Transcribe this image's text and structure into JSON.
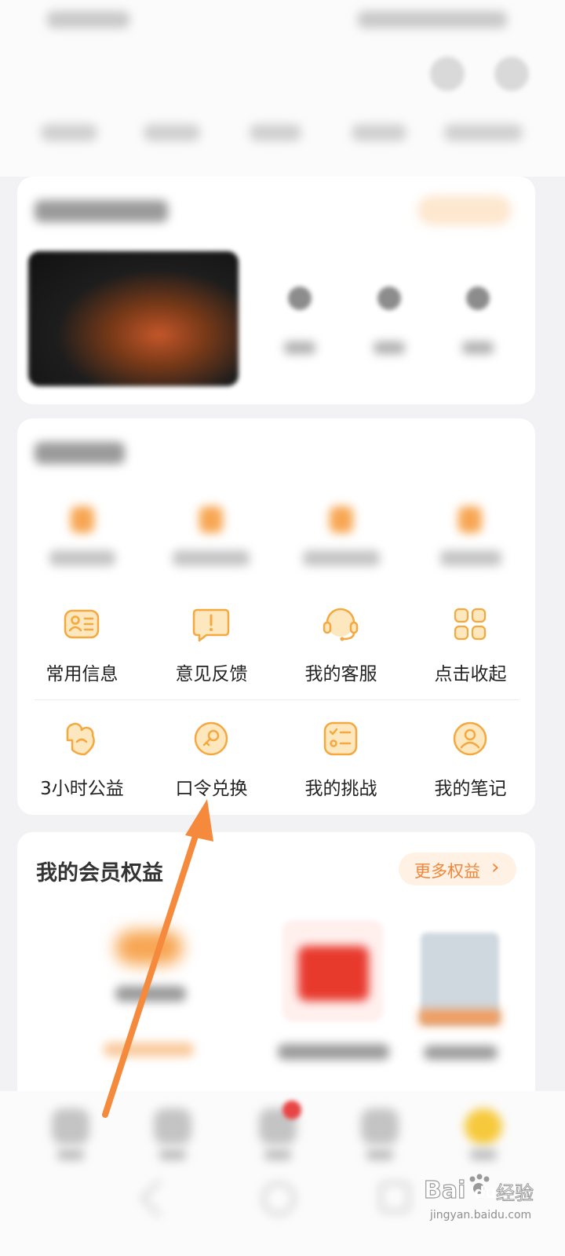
{
  "tools": {
    "row1": [
      {
        "label": "常用信息",
        "icon": "contact-card-icon"
      },
      {
        "label": "意见反馈",
        "icon": "feedback-bubble-icon"
      },
      {
        "label": "我的客服",
        "icon": "headset-icon"
      },
      {
        "label": "点击收起",
        "icon": "grid-collapse-icon"
      }
    ],
    "row2": [
      {
        "label": "3小时公益",
        "icon": "charity-heart-icon"
      },
      {
        "label": "口令兑换",
        "icon": "key-redeem-icon"
      },
      {
        "label": "我的挑战",
        "icon": "challenge-checklist-icon"
      },
      {
        "label": "我的笔记",
        "icon": "notes-person-icon"
      }
    ]
  },
  "member": {
    "title": "我的会员权益",
    "more_label": "更多权益",
    "more_chevron": "›"
  },
  "watermark": {
    "brand": "Baidu",
    "text": "经验",
    "url": "jingyan.baidu.com"
  },
  "colors": {
    "accent": "#f0863a",
    "icon_fill": "#fde7bf",
    "icon_stroke": "#f5a83e",
    "arrow": "#f58a3c"
  }
}
